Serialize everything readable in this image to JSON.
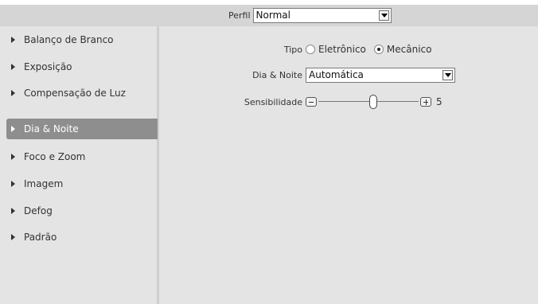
{
  "header": {
    "profile_label": "Perfil",
    "profile_value": "Normal"
  },
  "sidebar": {
    "items": [
      {
        "label": "Balanço de Branco",
        "active": false
      },
      {
        "label": "Exposição",
        "active": false
      },
      {
        "label": "Compensação de Luz",
        "active": false
      },
      {
        "label": "Dia & Noite",
        "active": true
      },
      {
        "label": "Foco e Zoom",
        "active": false
      },
      {
        "label": "Imagem",
        "active": false
      },
      {
        "label": "Defog",
        "active": false
      },
      {
        "label": "Padrão",
        "active": false
      }
    ]
  },
  "settings": {
    "tipo_label": "Tipo",
    "tipo_options": [
      {
        "label": "Eletrônico",
        "checked": false
      },
      {
        "label": "Mecânico",
        "checked": true
      }
    ],
    "dianoite_label": "Dia & Noite",
    "dianoite_value": "Automática",
    "sensibilidade_label": "Sensibilidade",
    "sensibilidade_value": "5",
    "sensibilidade_fraction": 0.55
  }
}
